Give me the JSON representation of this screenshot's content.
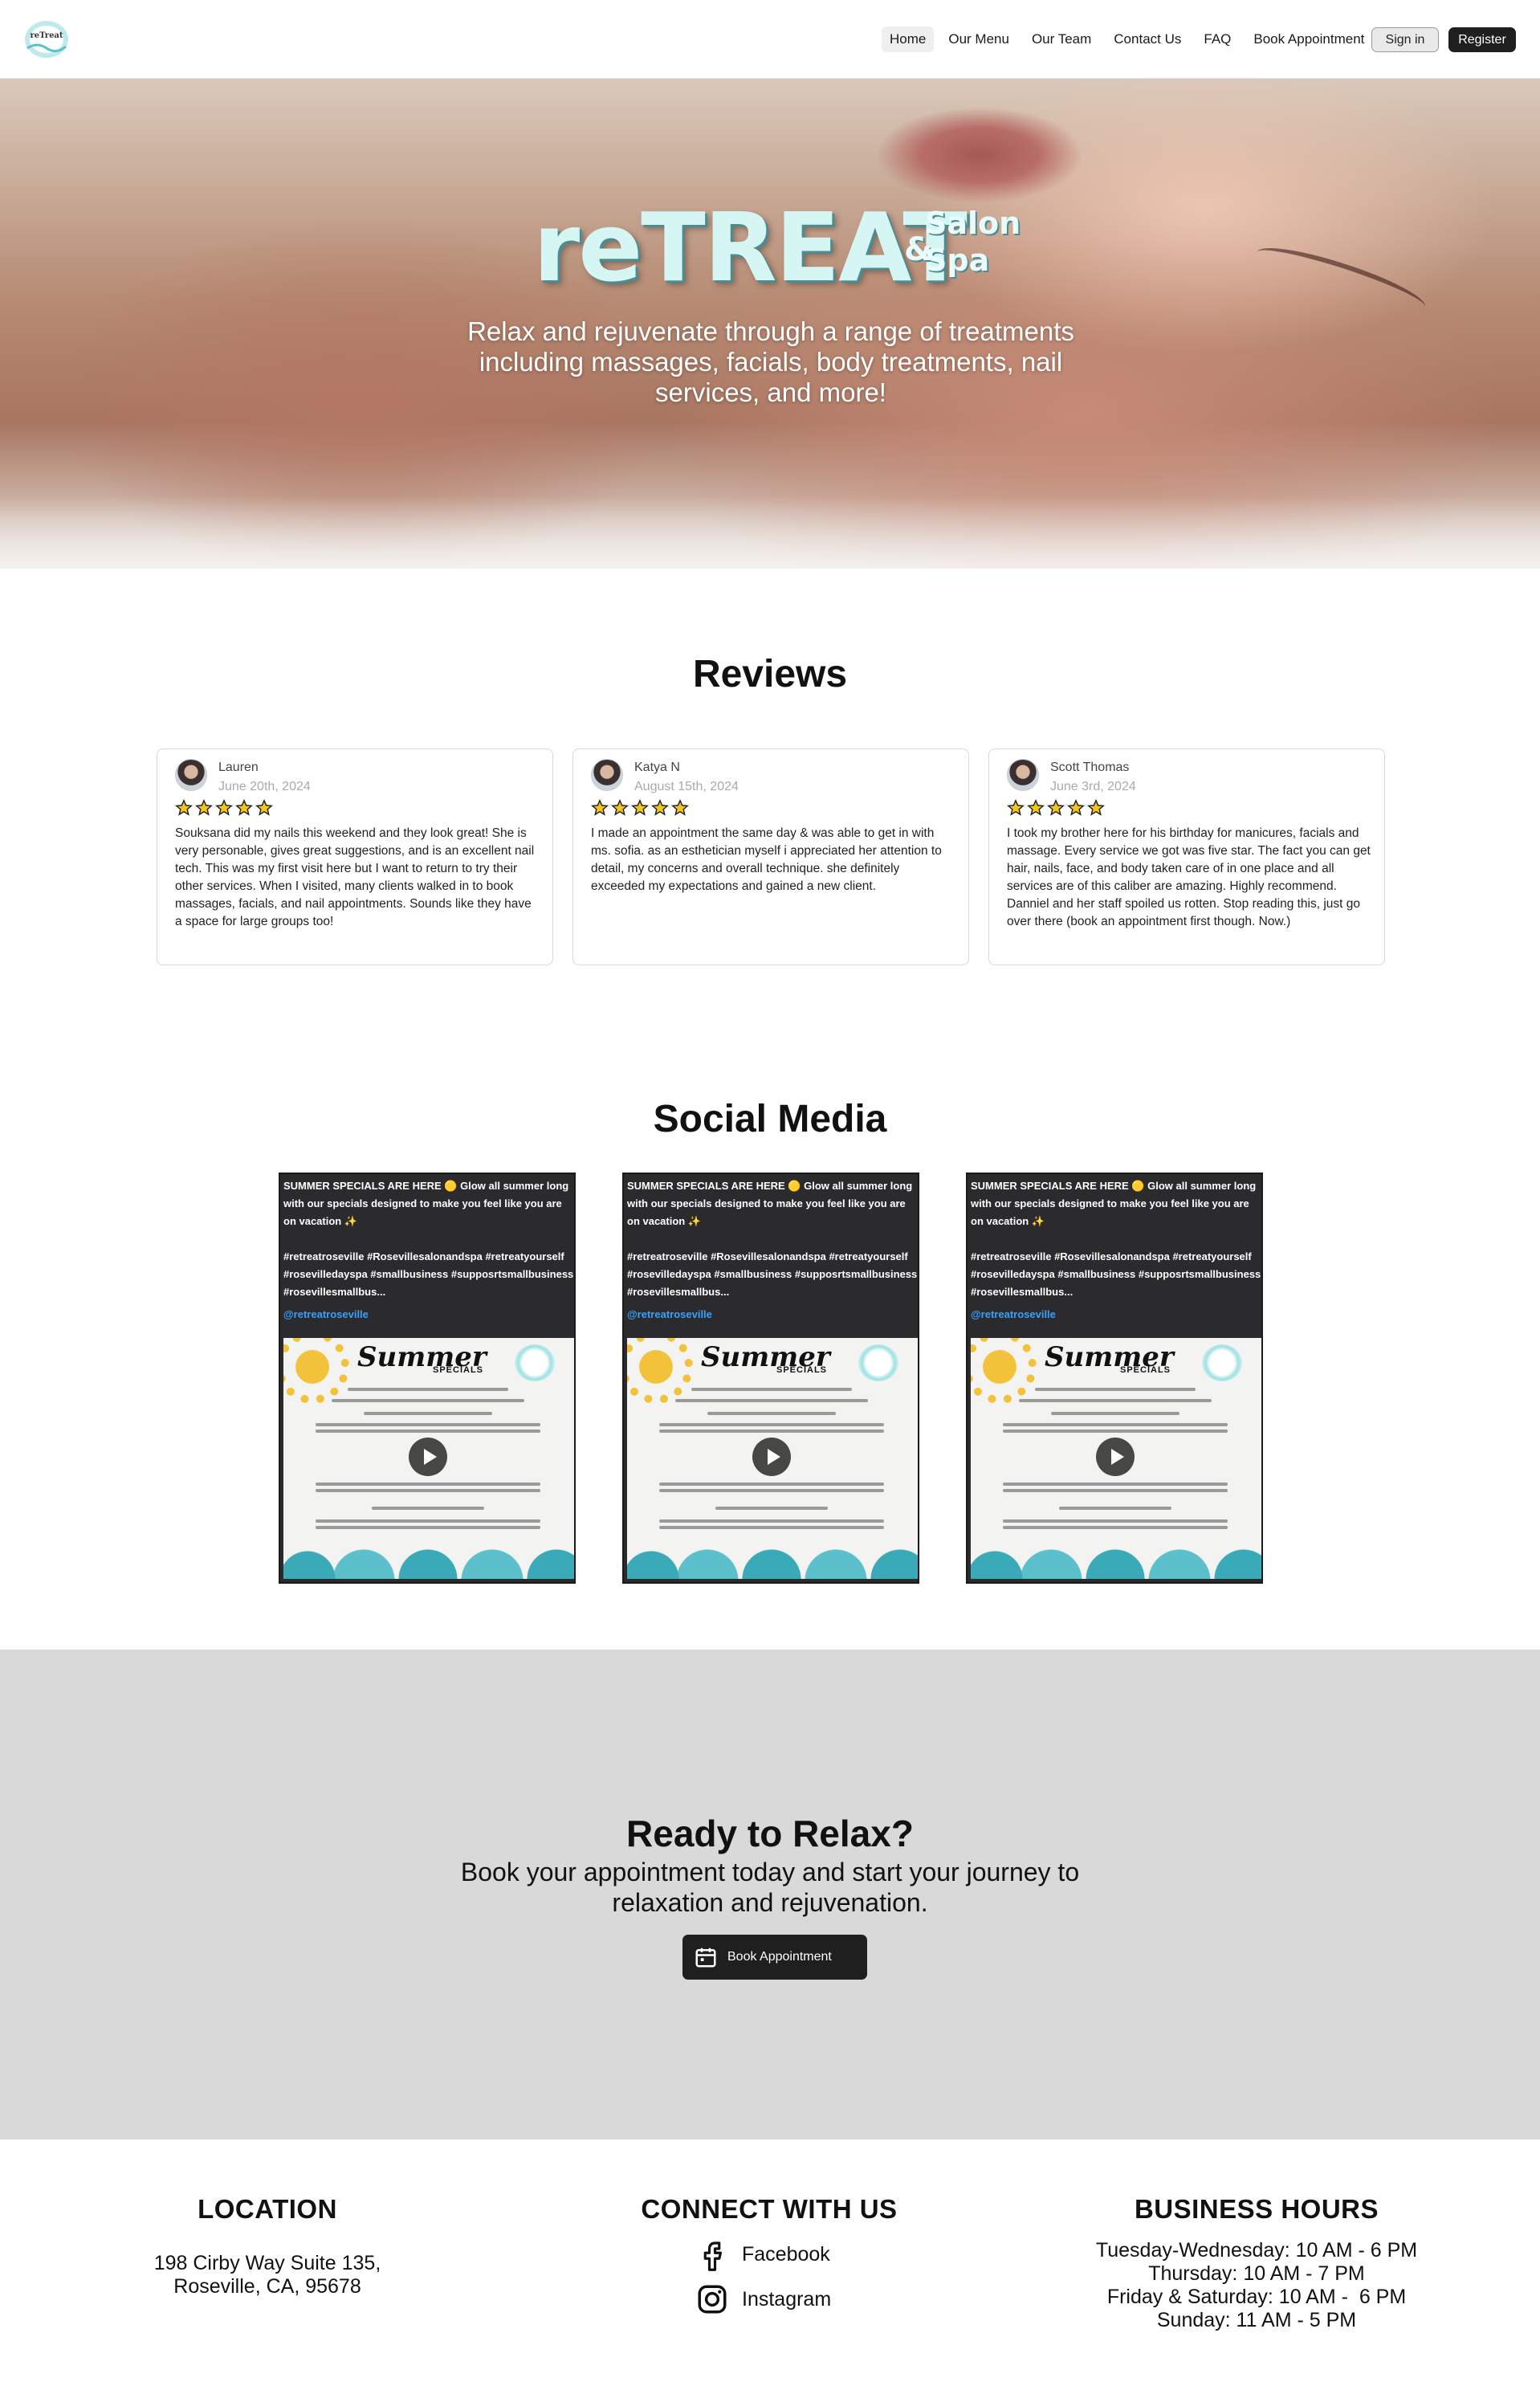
{
  "nav": {
    "links": [
      "Home",
      "Our Menu",
      "Our Team",
      "Contact Us",
      "FAQ",
      "Book Appointment"
    ],
    "sign_in": "Sign in",
    "register": "Register"
  },
  "hero": {
    "brand": "reTREAT",
    "brand_amp": "&",
    "brand_salon": "Salon",
    "brand_spa": "Spa",
    "tagline": "Relax and rejuvenate through a range of treatments including massages, facials, body treatments, nail services, and more!"
  },
  "reviews": {
    "title": "Reviews",
    "items": [
      {
        "name": "Lauren",
        "date": "June 20th, 2024",
        "rating": 5,
        "text": "Souksana did my nails this weekend and they look great! She is very personable, gives great suggestions, and is an excellent nail tech. This was my first visit here but I want to return to try their other services. When I visited, many clients walked in to book massages, facials, and nail appointments. Sounds like they have a space for large groups too!"
      },
      {
        "name": "Katya N",
        "date": "August 15th, 2024",
        "rating": 5,
        "text": "I made an appointment the same day & was able to get in with ms. sofia. as an esthetician myself i appreciated her attention to detail, my concerns and overall technique. she definitely exceeded my expectations and gained a new client."
      },
      {
        "name": "Scott Thomas",
        "date": "June 3rd, 2024",
        "rating": 5,
        "text": "I took my brother here for his birthday for manicures, facials and massage. Every service we got was five star. The fact you can get hair, nails, face, and body taken care of in one place and all services are of this caliber are amazing. Highly recommend. Danniel and her staff spoiled us rotten. Stop reading this, just go over there (book an appointment first though. Now.)"
      }
    ]
  },
  "social": {
    "title": "Social Media",
    "posts": [
      {
        "caption": "SUMMER SPECIALS ARE HERE 🟡 Glow all summer long with our specials designed to make you feel like you are on vacation ✨",
        "hashtags": "#retreatroseville #Rosevillesalonandspa #retreatyourself #rosevilledayspa #smallbusiness #supposrtsmallbusiness #rosevillesmallbus...",
        "handle": "@retreatroseville",
        "image_title": "Summer",
        "image_subtitle": "SPECIALS"
      },
      {
        "caption": "SUMMER SPECIALS ARE HERE 🟡 Glow all summer long with our specials designed to make you feel like you are on vacation ✨",
        "hashtags": "#retreatroseville #Rosevillesalonandspa #retreatyourself #rosevilledayspa #smallbusiness #supposrtsmallbusiness #rosevillesmallbus...",
        "handle": "@retreatroseville",
        "image_title": "Summer",
        "image_subtitle": "SPECIALS"
      },
      {
        "caption": "SUMMER SPECIALS ARE HERE 🟡 Glow all summer long with our specials designed to make you feel like you are on vacation ✨",
        "hashtags": "#retreatroseville #Rosevillesalonandspa #retreatyourself #rosevilledayspa #smallbusiness #supposrtsmallbusiness #rosevillesmallbus...",
        "handle": "@retreatroseville",
        "image_title": "Summer",
        "image_subtitle": "SPECIALS"
      }
    ]
  },
  "cta": {
    "title": "Ready to Relax?",
    "subtitle": "Book your appointment today and start your journey to relaxation and rejuvenation.",
    "button": "Book Appointment"
  },
  "footer": {
    "location_title": "LOCATION",
    "address_line1": "198 Cirby Way Suite 135,",
    "address_line2": "Roseville, CA, 95678",
    "connect_title": "CONNECT WITH US",
    "facebook": "Facebook",
    "instagram": "Instagram",
    "hours_title": "BUSINESS HOURS",
    "hours": [
      "Tuesday-Wednesday: 10 AM - 6 PM",
      "Thursday: 10 AM - 7 PM",
      "Friday & Saturday: 10 AM -  6 PM",
      "Sunday: 11 AM - 5 PM"
    ]
  },
  "colors": {
    "accent_dark": "#1f1f1f",
    "star": "#f5c518",
    "cta_bg": "#d9d9d9",
    "link_blue": "#3aa0ff"
  }
}
